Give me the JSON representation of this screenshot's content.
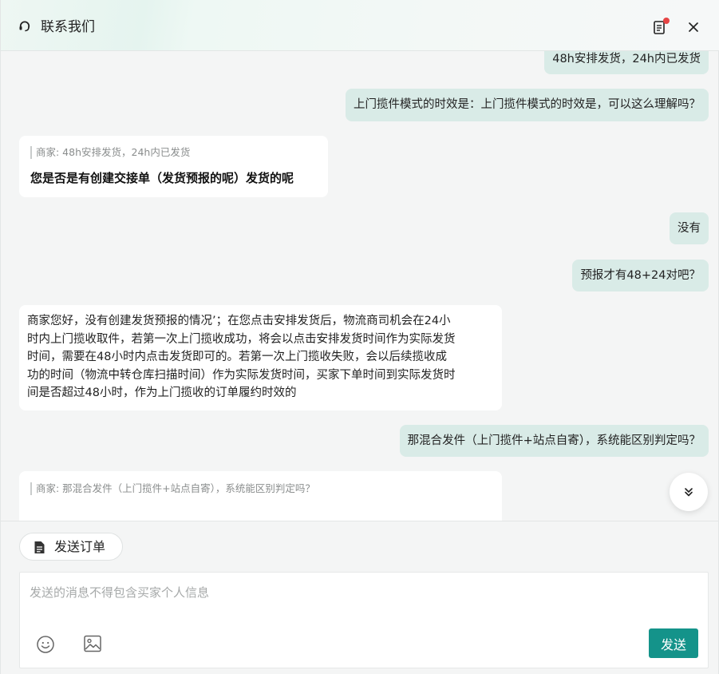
{
  "header": {
    "title": "联系我们",
    "icons": {
      "support": "headset-icon",
      "notes": "notes-icon",
      "close": "close-icon"
    }
  },
  "messages": [
    {
      "side": "right",
      "text": "48h安排发货，24h内已发货"
    },
    {
      "side": "right",
      "text": "上门揽件模式的时效是：上门揽件模式的时效是，可以这么理解吗？"
    },
    {
      "side": "left",
      "quote": "商家: 48h安排发货，24h内已发货",
      "text": "您是否是有创建交接单（发货预报的呢）发货的呢"
    },
    {
      "side": "right",
      "text": "没有"
    },
    {
      "side": "right",
      "text": "预报才有48+24对吧？"
    },
    {
      "side": "left",
      "lines": [
        "商家您好，没有创建发货预报的情况’；在您点击安排发货后，物流商司机会在24小",
        "时内上门揽收取件，若第一次上门揽收成功，将会以点击安排发货时间作为实际发货",
        "时间，需要在48小时内点击发货即可的。若第一次上门揽收失败，会以后续揽收成",
        "功的时间（物流中转仓库扫描时间）作为实际发货时间，买家下单时间到实际发货时",
        "间是否超过48小时，作为上门揽收的订单履约时效的"
      ]
    },
    {
      "side": "right",
      "text": "那混合发件（上门揽件+站点自寄），系统能区别判定吗？"
    },
    {
      "side": "left",
      "quote": "商家: 那混合发件（上门揽件+站点自寄），系统能区别判定吗？"
    }
  ],
  "footer": {
    "send_order_label": "发送订单",
    "input_placeholder": "发送的消息不得包含买家个人信息",
    "send_label": "发送",
    "icons": {
      "emoji": "emoji-icon",
      "image": "image-icon",
      "order": "document-icon",
      "scroll": "double-chevron-down-icon"
    }
  },
  "colors": {
    "accent": "#14938a",
    "right_bubble": "#d9ebe7",
    "left_bubble": "#ffffff",
    "notification_dot": "#e64545"
  }
}
